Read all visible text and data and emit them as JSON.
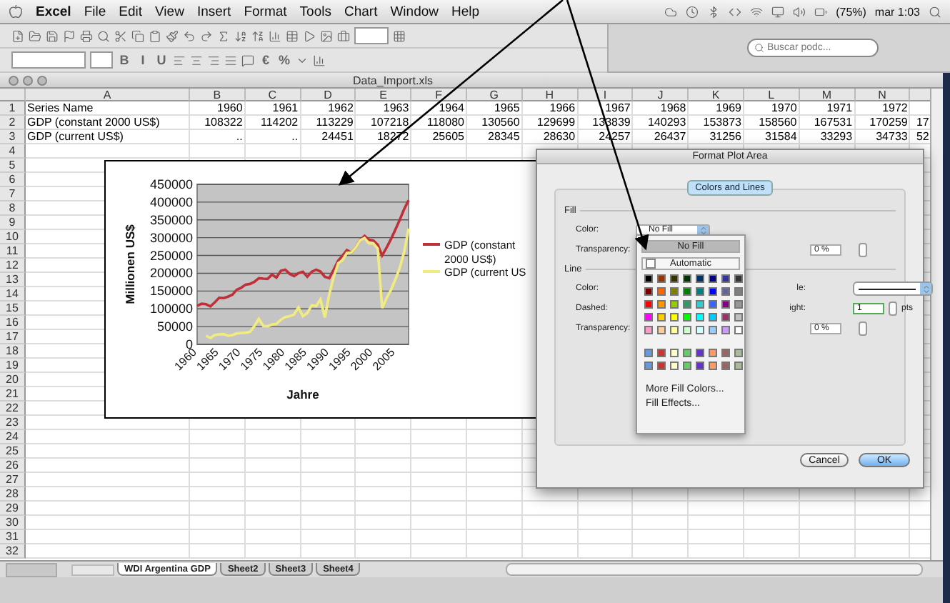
{
  "menubar": {
    "app": "Excel",
    "menus": [
      "File",
      "Edit",
      "View",
      "Insert",
      "Format",
      "Tools",
      "Chart",
      "Window",
      "Help"
    ],
    "battery": "(75%)",
    "clock": "mar 1:03"
  },
  "toolbar": {
    "format_buttons": [
      "B",
      "I",
      "U",
      "€",
      "%"
    ]
  },
  "background_window": {
    "search": {
      "placeholder": "Buscar podc..."
    }
  },
  "window": {
    "title": "Data_Import.xls"
  },
  "sheet": {
    "columns": [
      "A",
      "B",
      "C",
      "D",
      "E",
      "F",
      "G",
      "H",
      "I",
      "J",
      "K",
      "L",
      "M",
      "N"
    ],
    "rows": [
      {
        "number": "1",
        "cells": [
          "Series Name",
          "1960",
          "1961",
          "1962",
          "1963",
          "1964",
          "1965",
          "1966",
          "1967",
          "1968",
          "1969",
          "1970",
          "1971",
          "1972"
        ]
      },
      {
        "number": "2",
        "cells": [
          "GDP (constant 2000 US$)",
          "108322",
          "114202",
          "113229",
          "107218",
          "118080",
          "130560",
          "129699",
          "133839",
          "140293",
          "153873",
          "158560",
          "167531",
          "170259",
          "17"
        ]
      },
      {
        "number": "3",
        "cells": [
          "GDP (current US$)",
          "..",
          "..",
          "24451",
          "18272",
          "25605",
          "28345",
          "28630",
          "24257",
          "26437",
          "31256",
          "31584",
          "33293",
          "34733",
          "52"
        ]
      },
      {
        "number": "4",
        "cells": []
      },
      {
        "number": "5",
        "cells": []
      },
      {
        "number": "6",
        "cells": []
      },
      {
        "number": "7",
        "cells": []
      },
      {
        "number": "8",
        "cells": []
      },
      {
        "number": "9",
        "cells": []
      },
      {
        "number": "10",
        "cells": []
      },
      {
        "number": "11",
        "cells": []
      },
      {
        "number": "12",
        "cells": []
      },
      {
        "number": "13",
        "cells": []
      },
      {
        "number": "14",
        "cells": []
      },
      {
        "number": "15",
        "cells": []
      },
      {
        "number": "16",
        "cells": []
      },
      {
        "number": "17",
        "cells": []
      },
      {
        "number": "18",
        "cells": []
      },
      {
        "number": "19",
        "cells": []
      },
      {
        "number": "20",
        "cells": []
      },
      {
        "number": "21",
        "cells": []
      },
      {
        "number": "22",
        "cells": []
      },
      {
        "number": "23",
        "cells": []
      },
      {
        "number": "24",
        "cells": []
      },
      {
        "number": "25",
        "cells": []
      },
      {
        "number": "26",
        "cells": []
      },
      {
        "number": "27",
        "cells": []
      },
      {
        "number": "28",
        "cells": []
      },
      {
        "number": "29",
        "cells": []
      },
      {
        "number": "30",
        "cells": []
      },
      {
        "number": "31",
        "cells": []
      },
      {
        "number": "32",
        "cells": []
      }
    ]
  },
  "chart": {
    "chart_data": {
      "type": "line",
      "xlabel": "Jahre",
      "ylabel": "Millionen US$",
      "x": [
        1960,
        1961,
        1962,
        1963,
        1964,
        1965,
        1966,
        1967,
        1968,
        1969,
        1970,
        1971,
        1972,
        1973,
        1974,
        1975,
        1976,
        1977,
        1978,
        1979,
        1980,
        1981,
        1982,
        1983,
        1984,
        1985,
        1986,
        1987,
        1988,
        1989,
        1990,
        1991,
        1992,
        1993,
        1994,
        1995,
        1996,
        1997,
        1998,
        1999,
        2000,
        2001,
        2002,
        2003,
        2004,
        2005,
        2006,
        2007,
        2008
      ],
      "series": [
        {
          "name": "GDP (constant 2000 US$)",
          "color": "#c0303a",
          "values": [
            108000,
            114000,
            113000,
            107000,
            118000,
            131000,
            130000,
            134000,
            140000,
            154000,
            159000,
            168000,
            170000,
            176000,
            186000,
            185000,
            184000,
            196000,
            188000,
            207000,
            210000,
            198000,
            192000,
            200000,
            204000,
            190000,
            204000,
            210000,
            205000,
            190000,
            186000,
            210000,
            235000,
            250000,
            265000,
            258000,
            272000,
            294000,
            305000,
            294000,
            292000,
            280000,
            250000,
            272000,
            296000,
            323000,
            350000,
            380000,
            405000
          ]
        },
        {
          "name": "GDP (current US",
          "color": "#f2ec80",
          "values": [
            null,
            null,
            24000,
            18000,
            26000,
            28000,
            29000,
            24000,
            26000,
            31000,
            32000,
            33000,
            35000,
            52000,
            72000,
            52000,
            51000,
            56000,
            58000,
            69000,
            77000,
            79000,
            84000,
            104000,
            79000,
            88000,
            110000,
            108000,
            126000,
            76000,
            141000,
            190000,
            228000,
            237000,
            257000,
            258000,
            272000,
            293000,
            299000,
            284000,
            284000,
            269000,
            102000,
            130000,
            153000,
            183000,
            215000,
            260000,
            326000
          ]
        }
      ],
      "xticks": [
        1960,
        1965,
        1970,
        1975,
        1980,
        1985,
        1990,
        1995,
        2000,
        2005
      ],
      "yticks": [
        0,
        50000,
        100000,
        150000,
        200000,
        250000,
        300000,
        350000,
        400000,
        450000
      ],
      "ylim": [
        0,
        450000
      ],
      "xlim": [
        1960,
        2008
      ],
      "grid": true,
      "legend": "right"
    }
  },
  "dialog": {
    "title": "Format Plot Area",
    "tabs": [
      {
        "label": "Colors and Lines",
        "selected": true
      }
    ],
    "fill": {
      "heading": "Fill",
      "color_label": "Color:",
      "color_value": "No Fill",
      "transparency_label": "Transparency:",
      "transparency_value": "0 %"
    },
    "line": {
      "heading": "Line",
      "color_label": "Color:",
      "style_label": "le:",
      "dashed_label": "Dashed:",
      "weight_label": "ight:",
      "weight_value": "1",
      "weight_unit": "pts",
      "transparency_label": "Transparency:",
      "transparency_value": "0 %"
    },
    "color_menu": {
      "no_fill": {
        "label": "No Fill",
        "selected": true
      },
      "automatic": {
        "label": "Automatic",
        "selected": false
      },
      "swatches": [
        {
          "color": "#000000"
        },
        {
          "color": "#993300"
        },
        {
          "color": "#333300"
        },
        {
          "color": "#003300"
        },
        {
          "color": "#003366"
        },
        {
          "color": "#000080"
        },
        {
          "color": "#333399"
        },
        {
          "color": "#333333"
        },
        {
          "color": "#800000"
        },
        {
          "color": "#ff6600"
        },
        {
          "color": "#808000"
        },
        {
          "color": "#008000"
        },
        {
          "color": "#008080"
        },
        {
          "color": "#0000ff"
        },
        {
          "color": "#666699"
        },
        {
          "color": "#808080"
        },
        {
          "color": "#ff0000"
        },
        {
          "color": "#ff9900"
        },
        {
          "color": "#99cc00"
        },
        {
          "color": "#339966"
        },
        {
          "color": "#33cccc"
        },
        {
          "color": "#3366ff"
        },
        {
          "color": "#800080"
        },
        {
          "color": "#969696"
        },
        {
          "color": "#ff00ff"
        },
        {
          "color": "#ffcc00"
        },
        {
          "color": "#ffff00"
        },
        {
          "color": "#00ff00"
        },
        {
          "color": "#00ffff"
        },
        {
          "color": "#00ccff"
        },
        {
          "color": "#993366"
        },
        {
          "color": "#c0c0c0"
        },
        {
          "color": "#ff99cc"
        },
        {
          "color": "#ffcc99"
        },
        {
          "color": "#ffff99"
        },
        {
          "color": "#ccffcc"
        },
        {
          "color": "#ccffff"
        },
        {
          "color": "#99ccff"
        },
        {
          "color": "#cc99ff"
        },
        {
          "color": "#ffffff"
        }
      ],
      "chart_swatches": [
        {
          "color": "#6699dd"
        },
        {
          "color": "#cc3333"
        },
        {
          "color": "#ffffcc"
        },
        {
          "color": "#66cc66"
        },
        {
          "color": "#6633cc"
        },
        {
          "color": "#ff9966"
        },
        {
          "color": "#996666"
        },
        {
          "color": "#aabb99"
        },
        {
          "color": "#6699dd"
        },
        {
          "color": "#cc3333"
        },
        {
          "color": "#ffffcc"
        },
        {
          "color": "#66cc66"
        },
        {
          "color": "#6633cc"
        },
        {
          "color": "#ff9966"
        },
        {
          "color": "#996666"
        },
        {
          "color": "#aabb99"
        }
      ],
      "links": [
        "More Fill Colors...",
        "Fill Effects..."
      ]
    },
    "buttons": [
      {
        "label": "Cancel",
        "default": false
      },
      {
        "label": "OK",
        "default": true
      }
    ]
  },
  "sheet_tabs": [
    {
      "label": "WDI Argentina GDP",
      "selected": true
    },
    {
      "label": "Sheet2",
      "selected": false
    },
    {
      "label": "Sheet3",
      "selected": false
    },
    {
      "label": "Sheet4",
      "selected": false
    }
  ]
}
